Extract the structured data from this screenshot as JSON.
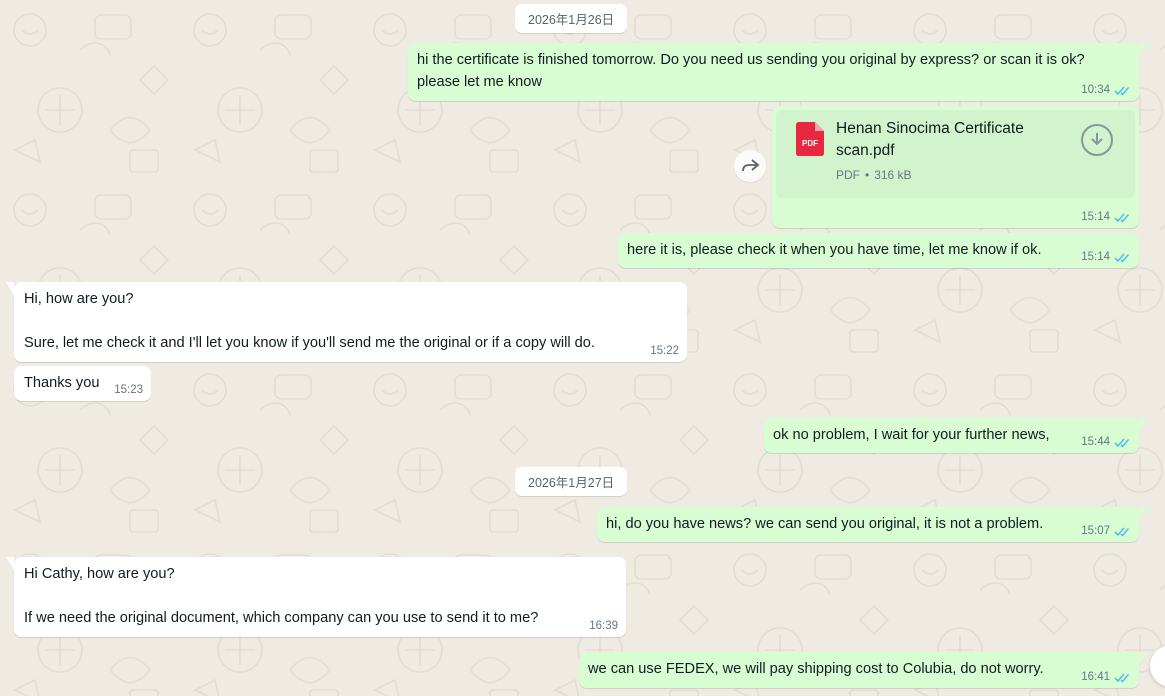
{
  "dates": [
    "2026年1月26日",
    "2026年1月27日"
  ],
  "messages": [
    {
      "dir": "out",
      "text": "hi the certificate is finished tomorrow. Do you need us sending you original by express? or scan it is ok? please let me know",
      "time": "10:34",
      "status": "read"
    },
    {
      "dir": "out",
      "type": "document",
      "file_name": "Henan Sinocima Certificate scan.pdf",
      "file_type": "PDF",
      "file_size": "316 kB",
      "icon": "pdf-icon",
      "time": "15:14",
      "status": "read"
    },
    {
      "dir": "out",
      "text": "here it is, please check it when you have time, let me know if ok.",
      "time": "15:14",
      "status": "read"
    },
    {
      "dir": "in",
      "text": "Hi, how are you?\n\nSure, let me check it and I'll let you know if you'll send me the original or if a copy will do.",
      "time": "15:22"
    },
    {
      "dir": "in",
      "text": "Thanks you",
      "time": "15:23"
    },
    {
      "dir": "out",
      "text": "ok no problem, I wait for your further news,",
      "time": "15:44",
      "status": "read"
    },
    {
      "dir": "out",
      "text": "hi, do you have news? we can send you original, it is not a problem.",
      "time": "15:07",
      "status": "read"
    },
    {
      "dir": "in",
      "text": "Hi Cathy, how are you?\n\nIf we need the original document, which company can you use to send it to me?",
      "time": "16:39"
    },
    {
      "dir": "out",
      "text": "we can use FEDEX, we will pay shipping cost to Colubia, do not worry.",
      "time": "16:41",
      "status": "read"
    }
  ],
  "icons": {
    "forward": "forward-icon",
    "download": "download-icon",
    "read_receipt": "double-check-icon",
    "scroll": "scroll-down-button"
  },
  "colors": {
    "outgoing_bubble": "#d9fdd3",
    "incoming_bubble": "#ffffff",
    "background": "#efeae2",
    "read_ticks": "#53bdeb",
    "pdf_red": "#e7283e"
  }
}
